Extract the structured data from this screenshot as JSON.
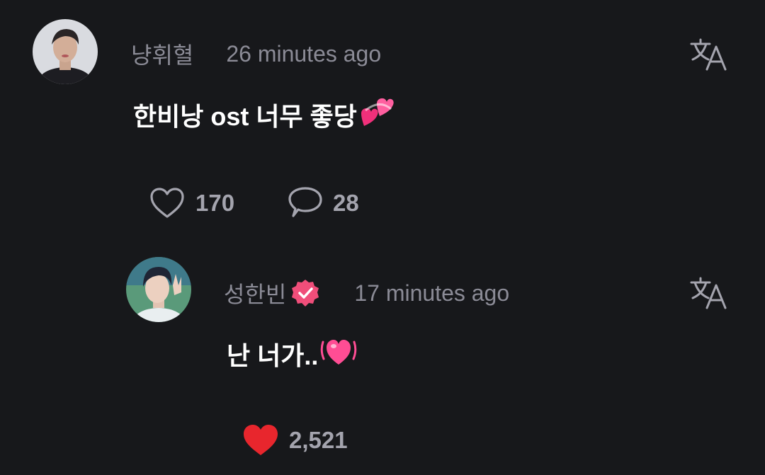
{
  "comment": {
    "username": "냥휘혈",
    "time": "26 minutes ago",
    "text": "한비낭 ost 너무 좋당",
    "emoji": "two-hearts",
    "likes": "170",
    "replies": "28",
    "liked": false
  },
  "reply": {
    "username": "성한빈",
    "verified": true,
    "time": "17 minutes ago",
    "text": "난 너가..",
    "emoji": "beating-heart",
    "likes": "2,521",
    "liked": true
  },
  "colors": {
    "background": "#17181b",
    "meta_text": "#8b8b96",
    "body_text": "#ffffff",
    "icon": "#a4a4ae",
    "like_active": "#e8262d",
    "verified_badge": "#f04e7a"
  }
}
